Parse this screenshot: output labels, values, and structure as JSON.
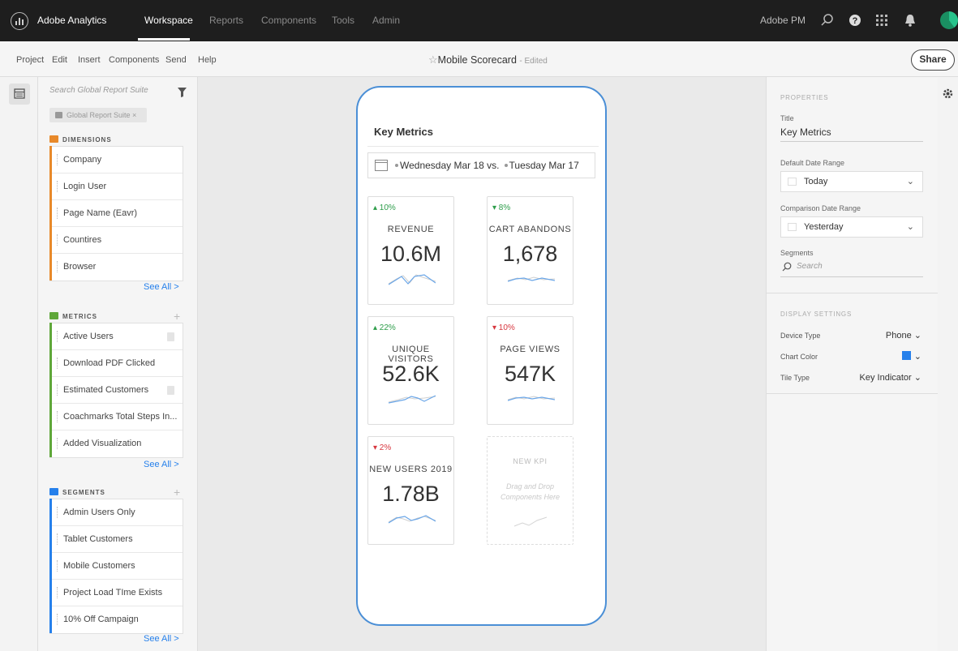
{
  "topbar": {
    "app_name": "Adobe Analytics",
    "nav": [
      "Workspace",
      "Reports",
      "Components",
      "Tools",
      "Admin"
    ],
    "active_nav": "Workspace",
    "org": "Adobe PM"
  },
  "menubar": {
    "items": [
      "Project",
      "Edit",
      "Insert",
      "Components",
      "Send",
      "Help"
    ],
    "project_title": "Mobile Scorecard",
    "edited": "- Edited",
    "share": "Share"
  },
  "left_panel": {
    "search_placeholder": "Search Global Report Suite",
    "report_suite_chip": "Global Report Suite ×",
    "dimensions": {
      "title": "DIMENSIONS",
      "color": "#e8892a",
      "items": [
        "Company",
        "Login User",
        "Page Name (Eavr)",
        "Countires",
        "Browser"
      ],
      "see_all": "See All >"
    },
    "metrics": {
      "title": "METRICS",
      "color": "#5fa73a",
      "items": [
        "Active Users",
        "Download PDF Clicked",
        "Estimated Customers",
        "Coachmarks Total Steps In...",
        "Added Visualization"
      ],
      "see_all": "See All >"
    },
    "segments": {
      "title": "SEGMENTS",
      "color": "#2680eb",
      "items": [
        "Admin Users Only",
        "Tablet Customers",
        "Mobile Customers",
        "Project Load TIme Exists",
        "10% Off Campaign"
      ],
      "see_all": "See All >"
    }
  },
  "phone": {
    "title": "Key Metrics",
    "date_primary": "Wednesday Mar 18 vs.",
    "date_compare": "Tuesday Mar 17",
    "tiles": [
      {
        "change": "▴ 10%",
        "direction": "up",
        "label": "REVENUE",
        "value": "10.6M"
      },
      {
        "change": "▾ 8%",
        "direction": "up",
        "label": "CART ABANDONS",
        "value": "1,678"
      },
      {
        "change": "▴ 22%",
        "direction": "up",
        "label": "UNIQUE VISITORS",
        "value": "52.6K"
      },
      {
        "change": "▾ 10%",
        "direction": "down",
        "label": "PAGE VIEWS",
        "value": "547K"
      },
      {
        "change": "▾ 2%",
        "direction": "down",
        "label": "NEW USERS 2019",
        "value": "1.78B"
      }
    ],
    "new_kpi": {
      "label": "NEW KPI",
      "hint_line1": "Drag and Drop",
      "hint_line2": "Components Here"
    }
  },
  "properties": {
    "section": "PROPERTIES",
    "title_label": "Title",
    "title_value": "Key Metrics",
    "default_range_label": "Default Date Range",
    "default_range_value": "Today",
    "comparison_range_label": "Comparison Date Range",
    "comparison_range_value": "Yesterday",
    "segments_label": "Segments",
    "segments_placeholder": "Search"
  },
  "display_settings": {
    "section": "DISPLAY SETTINGS",
    "device_type_label": "Device Type",
    "device_type_value": "Phone",
    "chart_color_label": "Chart Color",
    "chart_color": "#2680eb",
    "tile_type_label": "Tile Type",
    "tile_type_value": "Key Indicator"
  }
}
